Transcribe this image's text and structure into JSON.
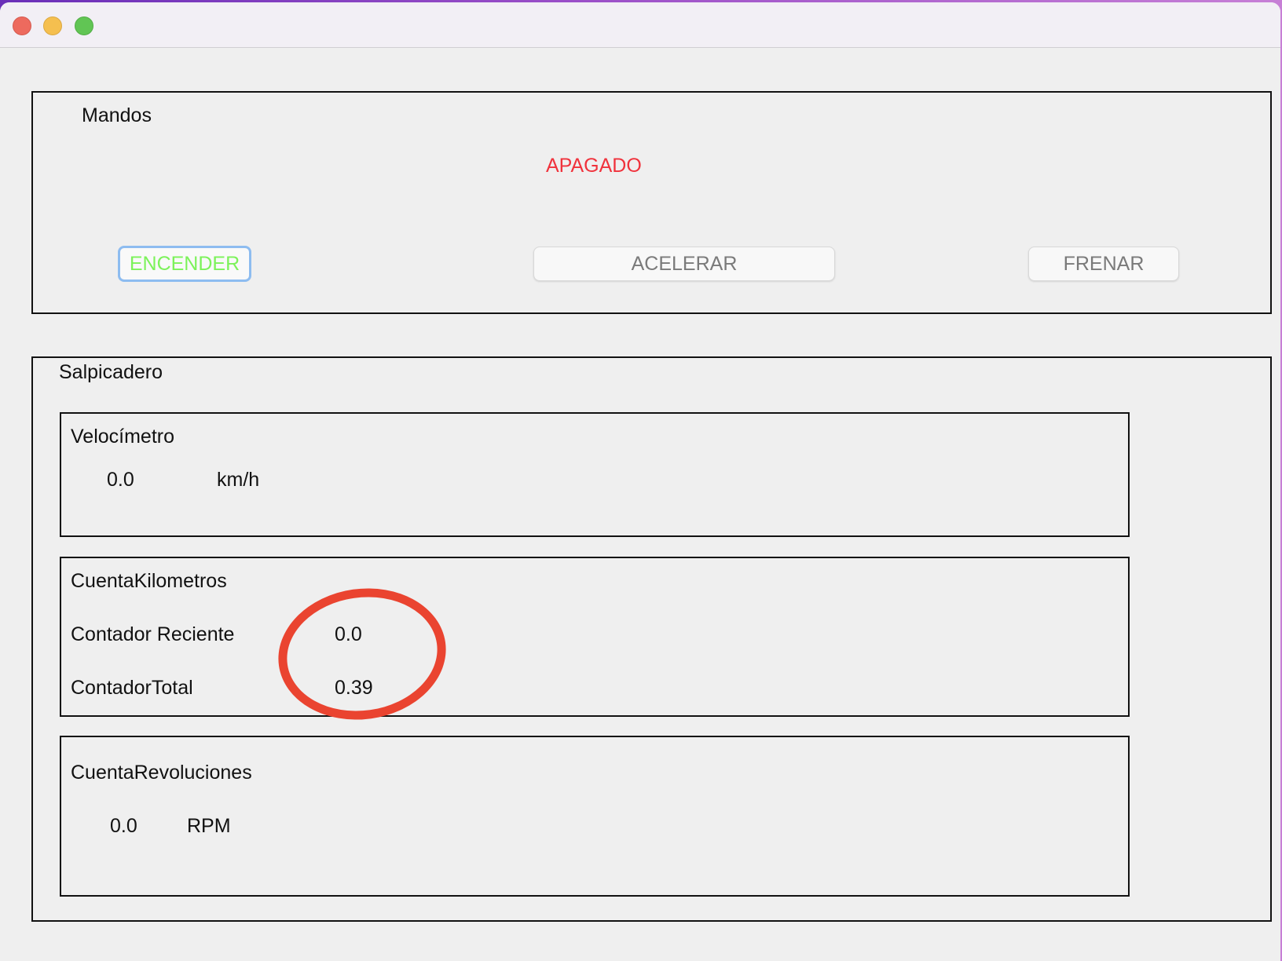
{
  "window": {
    "controls": [
      "close",
      "minimize",
      "zoom"
    ]
  },
  "mandos": {
    "title": "Mandos",
    "status": "APAGADO",
    "status_color": "#f0323c",
    "buttons": {
      "encender": "ENCENDER",
      "acelerar": "ACELERAR",
      "frenar": "FRENAR"
    },
    "encender_color": "#7cf25a"
  },
  "salpicadero": {
    "title": "Salpicadero",
    "velocimetro": {
      "title": "Velocímetro",
      "value": "0.0",
      "unit": "km/h"
    },
    "cuenta_kilometros": {
      "title": "CuentaKilometros",
      "reciente_label": "Contador Reciente",
      "reciente_value": "0.0",
      "total_label": "ContadorTotal",
      "total_value": "0.39"
    },
    "cuenta_revoluciones": {
      "title": "CuentaRevoluciones",
      "value": "0.0",
      "unit": "RPM"
    }
  },
  "annotation": {
    "color": "#ea4430",
    "icon": "red-ellipse-annotation"
  }
}
